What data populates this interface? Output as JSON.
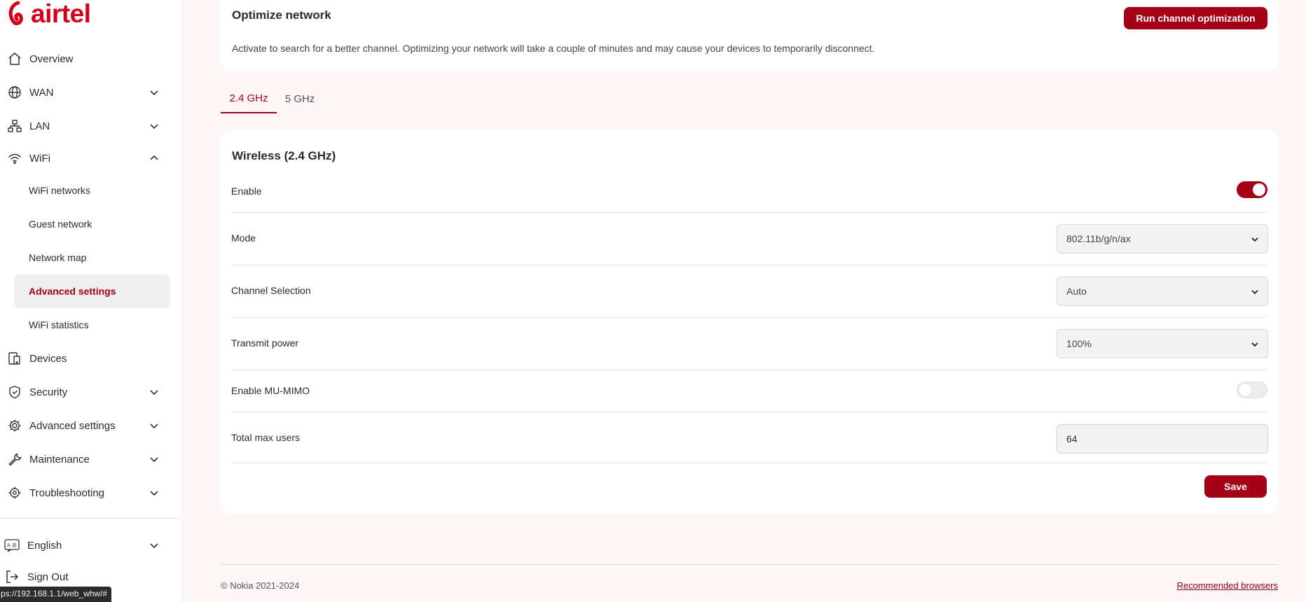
{
  "brand": {
    "logo_text": "airtel",
    "accent": "#a50018",
    "logo_color": "#d4001a"
  },
  "sidebar": {
    "items": [
      {
        "label": "Overview",
        "icon": "home-icon"
      },
      {
        "label": "WAN",
        "icon": "globe-icon",
        "expandable": true
      },
      {
        "label": "LAN",
        "icon": "lan-icon",
        "expandable": true
      },
      {
        "label": "WiFi",
        "icon": "wifi-icon",
        "expandable": true,
        "expanded": true
      },
      {
        "label": "Devices",
        "icon": "devices-icon"
      },
      {
        "label": "Security",
        "icon": "shield-icon",
        "expandable": true
      },
      {
        "label": "Advanced settings",
        "icon": "gear-icon",
        "expandable": true
      },
      {
        "label": "Maintenance",
        "icon": "wrench-icon",
        "expandable": true
      },
      {
        "label": "Troubleshooting",
        "icon": "crosshair-icon",
        "expandable": true
      }
    ],
    "wifi_sub": [
      "WiFi networks",
      "Guest network",
      "Network map",
      "Advanced settings",
      "WiFi statistics"
    ],
    "active_sub": "Advanced settings",
    "language": "English",
    "sign_out": "Sign Out"
  },
  "status_url": "ps://192.168.1.1/web_whw/#",
  "optimize": {
    "title": "Optimize network",
    "description": "Activate to search for a better channel. Optimizing your network will take a couple of minutes and may cause your devices to temporarily disconnect.",
    "button": "Run channel optimization"
  },
  "tabs": [
    {
      "label": "2.4 GHz",
      "active": true
    },
    {
      "label": "5 GHz",
      "active": false
    }
  ],
  "wireless": {
    "title": "Wireless (2.4 GHz)",
    "enable_label": "Enable",
    "enable_on": true,
    "mode_label": "Mode",
    "mode_value": "802.11b/g/n/ax",
    "channel_label": "Channel Selection",
    "channel_value": "Auto",
    "power_label": "Transmit power",
    "power_value": "100%",
    "mumimo_label": "Enable MU-MIMO",
    "mumimo_on": false,
    "max_users_label": "Total max users",
    "max_users_value": "64",
    "save": "Save"
  },
  "footer": {
    "copyright": "© Nokia 2021-2024",
    "link": "Recommended browsers"
  }
}
